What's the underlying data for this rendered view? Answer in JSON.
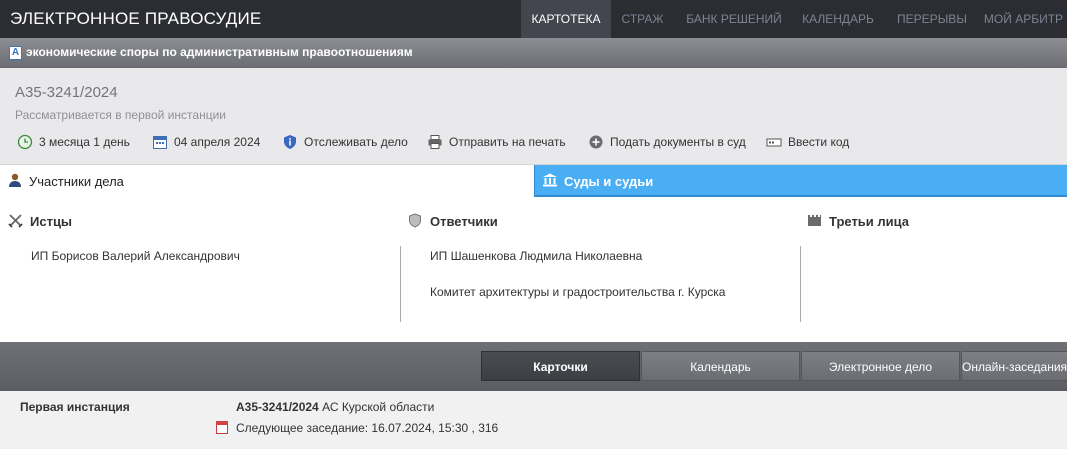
{
  "header": {
    "logo": "ЭЛЕКТРОННОЕ ПРАВОСУДИЕ",
    "nav": [
      "КАРТОТЕКА",
      "СТРАЖ",
      "БАНК РЕШЕНИЙ",
      "КАЛЕНДАРЬ",
      "ПЕРЕРЫВЫ",
      "МОЙ АРБИТР"
    ],
    "active_nav": "КАРТОТЕКА"
  },
  "category": {
    "icon": "A",
    "text": "экономические споры по административным правоотношениям"
  },
  "case": {
    "number": "А35-3241/2024",
    "status": "Рассматривается в первой инстанции",
    "toolbar": {
      "duration": "3 месяца 1 день",
      "date": "04 апреля 2024",
      "track": "Отслеживать дело",
      "print": "Отправить на печать",
      "submit": "Подать документы в суд",
      "code": "Ввести код"
    }
  },
  "tabs": {
    "participants": "Участники дела",
    "courts": "Суды и судьи"
  },
  "participants": {
    "plaintiffs": {
      "title": "Истцы",
      "items": [
        "ИП Борисов Валерий Александрович"
      ]
    },
    "defendants": {
      "title": "Ответчики",
      "items": [
        "ИП Шашенкова Людмила Николаевна",
        "Комитет архитектуры и градостроительства г. Курска"
      ]
    },
    "third_parties": {
      "title": "Третьи лица",
      "items": []
    }
  },
  "bottom_tabs": [
    "Карточки",
    "Календарь",
    "Электронное дело",
    "Онлайн-заседания"
  ],
  "instance": {
    "label": "Первая инстанция",
    "case_number": "А35-3241/2024",
    "court": "АС Курской области",
    "next_session": "Следующее заседание: 16.07.2024, 15:30 , 316"
  },
  "colors": {
    "topbar": "#2b2d33",
    "accent_blue": "#4aaef5",
    "bottombar": "#5b5d63"
  }
}
